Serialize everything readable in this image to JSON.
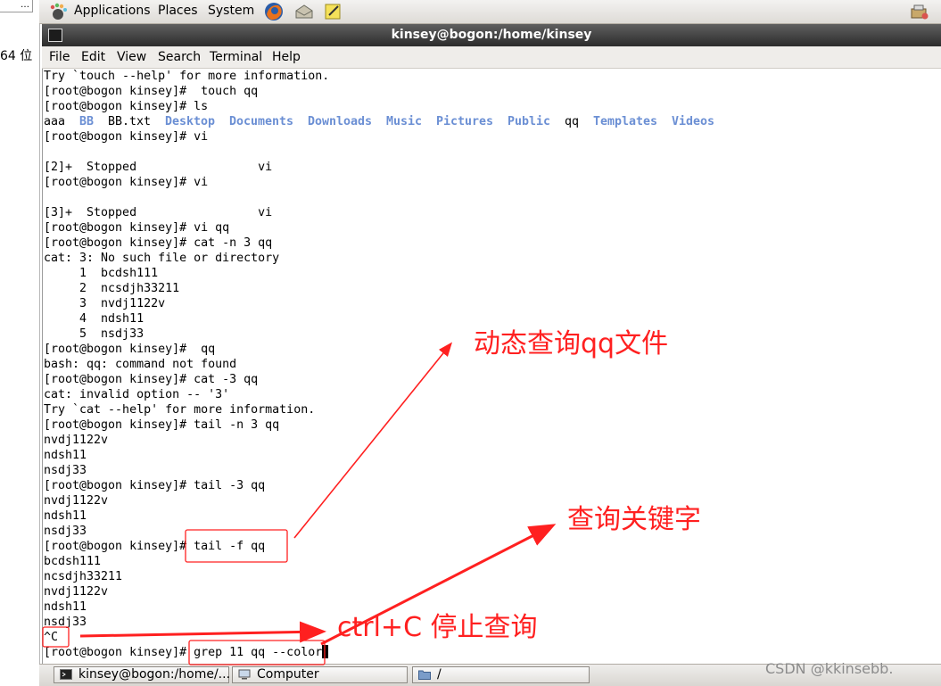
{
  "left_pane": {
    "dropdown_text": "…",
    "fragment": "64 位"
  },
  "top_panel": {
    "menus": [
      "Applications",
      "Places",
      "System"
    ],
    "icons": [
      "gnome-foot-icon",
      "firefox-icon",
      "email-icon",
      "notes-icon",
      "network-icon"
    ]
  },
  "window": {
    "title": "kinsey@bogon:/home/kinsey"
  },
  "menubar": [
    "File",
    "Edit",
    "View",
    "Search",
    "Terminal",
    "Help"
  ],
  "terminal": {
    "lines": [
      "Try `touch --help' for more information.",
      "[root@bogon kinsey]#  touch qq",
      "[root@bogon kinsey]# ls",
      "",
      "[root@bogon kinsey]# vi",
      "",
      "[2]+  Stopped                 vi",
      "[root@bogon kinsey]# vi",
      "",
      "[3]+  Stopped                 vi",
      "[root@bogon kinsey]# vi qq",
      "[root@bogon kinsey]# cat -n 3 qq",
      "cat: 3: No such file or directory",
      "     1  bcdsh111",
      "     2  ncsdjh33211",
      "     3  nvdj1122v",
      "     4  ndsh11",
      "     5  nsdj33",
      "[root@bogon kinsey]#  qq",
      "bash: qq: command not found",
      "[root@bogon kinsey]# cat -3 qq",
      "cat: invalid option -- '3'",
      "Try `cat --help' for more information.",
      "[root@bogon kinsey]# tail -n 3 qq",
      "nvdj1122v",
      "ndsh11",
      "nsdj33",
      "[root@bogon kinsey]# tail -3 qq",
      "nvdj1122v",
      "ndsh11",
      "nsdj33",
      "[root@bogon kinsey]# tail -f qq",
      "bcdsh111",
      "ncsdjh33211",
      "nvdj1122v",
      "ndsh11",
      "nsdj33",
      "^C",
      "[root@bogon kinsey]# grep 11 qq --color"
    ],
    "ls_output": [
      {
        "name": "aaa",
        "kind": "file"
      },
      {
        "name": "BB",
        "kind": "dir"
      },
      {
        "name": "BB.txt",
        "kind": "file"
      },
      {
        "name": "Desktop",
        "kind": "dir"
      },
      {
        "name": "Documents",
        "kind": "dir"
      },
      {
        "name": "Downloads",
        "kind": "dir"
      },
      {
        "name": "Music",
        "kind": "dir"
      },
      {
        "name": "Pictures",
        "kind": "dir"
      },
      {
        "name": "Public",
        "kind": "dir"
      },
      {
        "name": "qq",
        "kind": "file"
      },
      {
        "name": "Templates",
        "kind": "dir"
      },
      {
        "name": "Videos",
        "kind": "dir"
      }
    ],
    "dir_color": "#6b8fd4"
  },
  "taskbar": [
    {
      "label": "kinsey@bogon:/home/...",
      "icon": "terminal-icon",
      "active": true
    },
    {
      "label": "Computer",
      "icon": "computer-icon",
      "active": false
    },
    {
      "label": "/",
      "icon": "folder-icon",
      "active": false
    }
  ],
  "annotations": [
    {
      "text": "动态查询qq文件",
      "color": "#ff2020"
    },
    {
      "text": "查询关键字",
      "color": "#ff2020"
    },
    {
      "text": "ctrl+C  停止查询",
      "color": "#ff2020"
    }
  ],
  "watermark": "CSDN @kkinsebb."
}
